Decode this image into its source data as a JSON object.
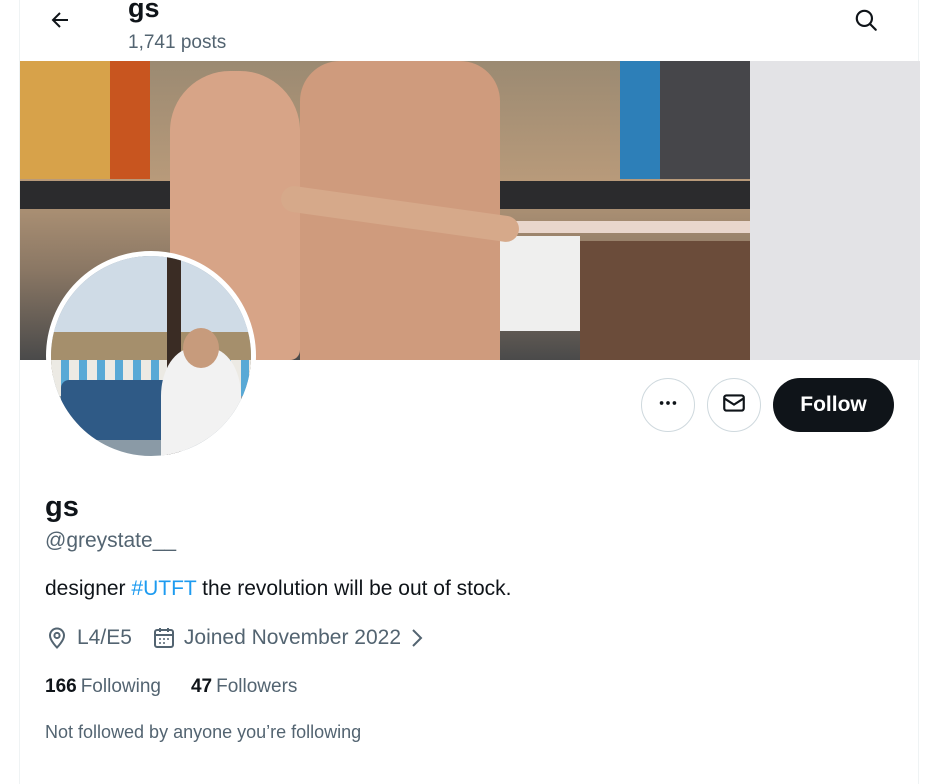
{
  "header": {
    "name": "gs",
    "posts_count": "1,741 posts"
  },
  "actions": {
    "follow_label": "Follow"
  },
  "profile": {
    "display_name": "gs",
    "handle": "@greystate__",
    "bio_prefix": "designer ",
    "bio_hashtag": "#UTFT",
    "bio_suffix": " the revolution will be out of stock.",
    "location": "L4/E5",
    "joined": "Joined November 2022",
    "following_count": "166",
    "following_label": "Following",
    "followers_count": "47",
    "followers_label": "Followers",
    "not_followed_text": "Not followed by anyone you’re following"
  },
  "colors": {
    "accent": "#1d9bf0",
    "follow_button_bg": "#0f1419",
    "secondary_text": "#536471"
  },
  "icons": {
    "back": "arrow-left-icon",
    "search": "search-icon",
    "more": "more-horizontal-icon",
    "message": "envelope-icon",
    "location": "location-pin-icon",
    "calendar": "calendar-icon",
    "chevron": "chevron-right-icon"
  }
}
